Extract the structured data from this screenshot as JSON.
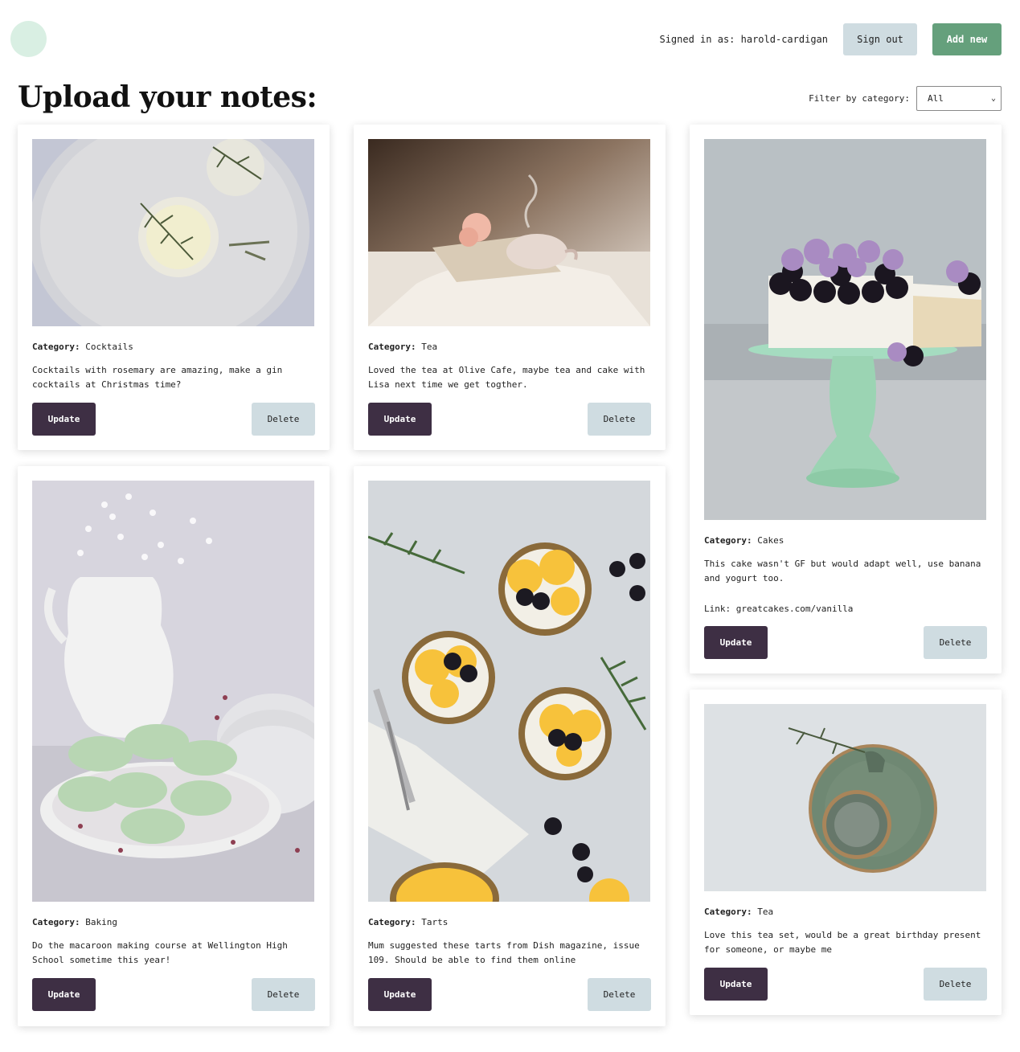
{
  "header": {
    "signed_in_label": "Signed in as: harold-cardigan",
    "sign_out_label": "Sign out",
    "add_new_label": "Add new",
    "logo_color": "#d9efe3"
  },
  "page": {
    "title": "Upload your notes:"
  },
  "filter": {
    "label": "Filter by category:",
    "selected": "All"
  },
  "cards": [
    {
      "category_label": "Category:",
      "category": "Cocktails",
      "description": "Cocktails with rosemary are amazing, make a gin cocktails at Christmas time?",
      "link": "",
      "image_subject": "cocktail glasses with rosemary on a tray",
      "update_label": "Update",
      "delete_label": "Delete"
    },
    {
      "category_label": "Category:",
      "category": "Tea",
      "description": "Loved the tea at Olive Cafe, maybe tea and cake with Lisa next time we get togther.",
      "link": "",
      "image_subject": "steaming teacup on a book in bed",
      "update_label": "Update",
      "delete_label": "Delete"
    },
    {
      "category_label": "Category:",
      "category": "Cakes",
      "description": "This cake wasn't GF but would adapt well, use banana and yogurt too.",
      "link": "Link: greatcakes.com/vanilla",
      "image_subject": "cake with blackberries on green cake stand",
      "update_label": "Update",
      "delete_label": "Delete"
    },
    {
      "category_label": "Category:",
      "category": "Baking",
      "description": "Do the macaroon making course at Wellington High School sometime this year!",
      "link": "",
      "image_subject": "green macarons on a plate with white jug",
      "update_label": "Update",
      "delete_label": "Delete"
    },
    {
      "category_label": "Category:",
      "category": "Tarts",
      "description": "Mum suggested these tarts from Dish magazine, issue 109. Should be able to find them online",
      "link": "",
      "image_subject": "orange and blackberry tarts",
      "update_label": "Update",
      "delete_label": "Delete"
    },
    {
      "category_label": "Category:",
      "category": "Tea",
      "description": "Love this tea set, would be a great birthday present for someone, or maybe me",
      "link": "",
      "image_subject": "green ceramic tea set",
      "update_label": "Update",
      "delete_label": "Delete"
    }
  ],
  "colors": {
    "update_button": "#3e2f44",
    "delete_button": "#cfdce1",
    "add_new_button": "#65a07c"
  }
}
